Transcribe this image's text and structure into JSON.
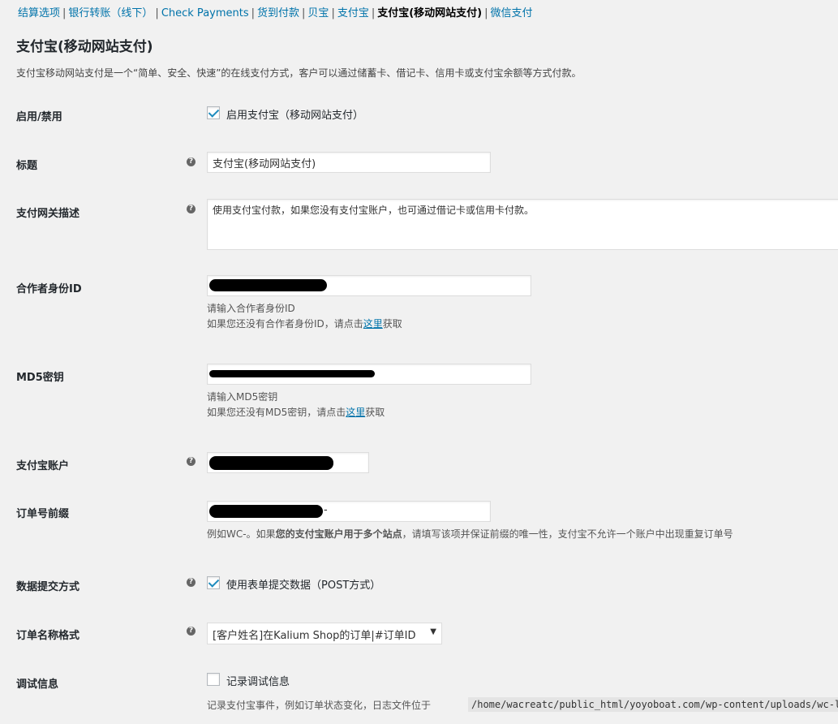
{
  "subnav": {
    "items": [
      {
        "label": "结算选项",
        "current": false
      },
      {
        "label": "银行转账（线下）",
        "current": false
      },
      {
        "label": "Check Payments",
        "current": false
      },
      {
        "label": "货到付款",
        "current": false
      },
      {
        "label": "贝宝",
        "current": false
      },
      {
        "label": "支付宝",
        "current": false
      },
      {
        "label": "支付宝(移动网站支付)",
        "current": true
      },
      {
        "label": "微信支付",
        "current": false
      }
    ]
  },
  "heading": "支付宝(移动网站支付)",
  "intro": "支付宝移动网站支付是一个“简单、安全、快速”的在线支付方式，客户可以通过储蓄卡、借记卡、信用卡或支付宝余额等方式付款。",
  "fields": {
    "enable": {
      "label": "启用/禁用",
      "checkbox_label": "启用支付宝（移动网站支付）",
      "checked": true
    },
    "title": {
      "label": "标题",
      "value": "支付宝(移动网站支付)"
    },
    "gateway_desc": {
      "label": "支付网关描述",
      "value": "使用支付宝付款，如果您没有支付宝账户，也可通过借记卡或信用卡付款。"
    },
    "partner_id": {
      "label": "合作者身份ID",
      "hint1": "请输入合作者身份ID",
      "hint2_pre": "如果您还没有合作者身份ID，请点击",
      "hint2_link": "这里",
      "hint2_post": "获取"
    },
    "md5_key": {
      "label": "MD5密钥",
      "hint1": "请输入MD5密钥",
      "hint2_pre": "如果您还没有MD5密钥，请点击",
      "hint2_link": "这里",
      "hint2_post": "获取"
    },
    "account": {
      "label": "支付宝账户"
    },
    "order_prefix": {
      "label": "订单号前缀",
      "value_suffix": "-",
      "hint_pre": "例如WC-。如果",
      "hint_bold": "您的支付宝账户用于多个站点",
      "hint_post": "，请填写该项并保证前缀的唯一性，支付宝不允许一个账户中出现重复订单号"
    },
    "submit_method": {
      "label": "数据提交方式",
      "checkbox_label": "使用表单提交数据（POST方式）",
      "checked": true
    },
    "order_name_format": {
      "label": "订单名称格式",
      "selected": "[客户姓名]在Kalium Shop的订单|#订单ID"
    },
    "debug": {
      "label": "调试信息",
      "checkbox_label": "记录调试信息",
      "checked": false,
      "hint_pre": "记录支付宝事件，例如订单状态变化，日志文件位于",
      "path": "/home/wacreatc/public_html/yoyoboat.com/wp-content/uploads/wc-l"
    }
  },
  "help_icon": "question-circle-icon"
}
